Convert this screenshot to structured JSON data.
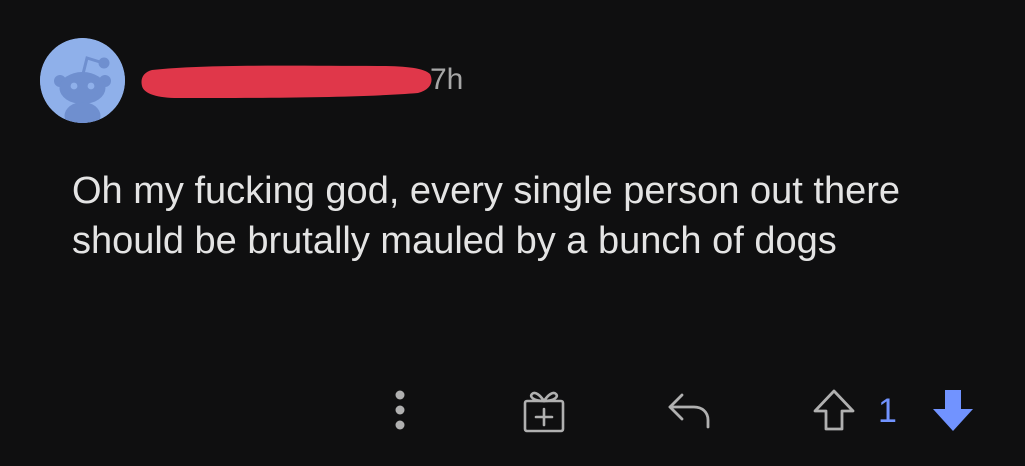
{
  "comment": {
    "timestamp": "7h",
    "body": "Oh my fucking god, every single person out there should be brutally mauled by a bunch of dogs",
    "username_state": "redacted",
    "avatar": {
      "icon": "snoo-avatar-icon",
      "background_color": "#8fb0ea"
    }
  },
  "actions": {
    "more": {
      "icon": "more-vertical-icon"
    },
    "award": {
      "icon": "gift-icon"
    },
    "reply": {
      "icon": "reply-icon"
    },
    "upvote": {
      "icon": "upvote-arrow-icon"
    },
    "vote_count": "1",
    "downvote": {
      "icon": "downvote-arrow-icon",
      "active": true
    }
  },
  "colors": {
    "background": "#0f0f10",
    "text": "#e4e4e4",
    "muted_text": "#a7a7a7",
    "redaction": "#e0374a",
    "vote_accent": "#7193ff",
    "icon": "#b0b0b0"
  }
}
